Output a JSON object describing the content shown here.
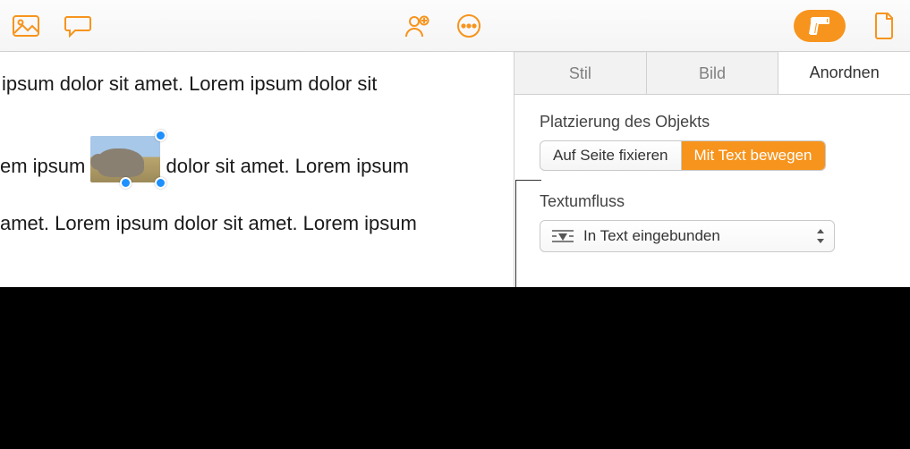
{
  "toolbar": {
    "icons": {
      "media": "media-icon",
      "comment": "comment-icon",
      "collaborate": "collaborate-icon",
      "more": "more-icon",
      "format": "format-icon",
      "document": "document-icon"
    }
  },
  "doc": {
    "line1": "ipsum dolor sit amet.  Lorem ipsum dolor sit",
    "line2_before": "em ipsum ",
    "line2_after": "dolor sit amet. Lorem ipsum",
    "line3": "amet. Lorem ipsum dolor sit amet. Lorem ipsum"
  },
  "tabs": {
    "stil": "Stil",
    "bild": "Bild",
    "anordnen": "Anordnen"
  },
  "panel": {
    "placement_heading": "Platzierung des Objekts",
    "seg_fix": "Auf Seite fixieren",
    "seg_move": "Mit Text bewegen",
    "wrap_heading": "Textumfluss",
    "wrap_value": "In Text eingebunden"
  }
}
